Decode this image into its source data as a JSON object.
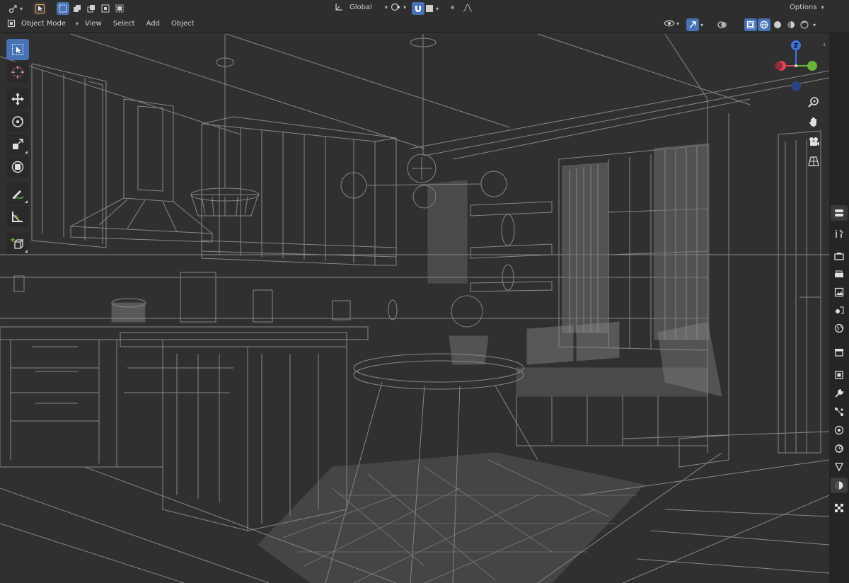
{
  "header": {
    "transform_orientation": "Global",
    "options_label": "Options"
  },
  "menubar": {
    "mode_label": "Object Mode",
    "view_label": "View",
    "select_label": "Select",
    "add_label": "Add",
    "object_label": "Object"
  },
  "toolbar": {
    "tools": [
      "select-box",
      "cursor",
      "move",
      "rotate",
      "scale",
      "transform",
      "annotate",
      "measure",
      "add-cube"
    ],
    "active_tool": "select-box"
  },
  "gizmo": {
    "z_label": "Z",
    "colors": {
      "x": "#e04458",
      "y": "#6ab43a",
      "z": "#3d74e0"
    }
  },
  "viewport": {
    "shading": "wireframe",
    "background": "#303030",
    "wire_color": "#9a9a9a"
  },
  "properties_tabs": [
    "tool",
    "render",
    "output",
    "view-layer",
    "scene",
    "world",
    "collection",
    "object",
    "modifiers",
    "particles",
    "physics",
    "constraints",
    "data",
    "material",
    "texture"
  ],
  "colors": {
    "accent": "#4772b3",
    "highlight": "#e7a54b"
  }
}
